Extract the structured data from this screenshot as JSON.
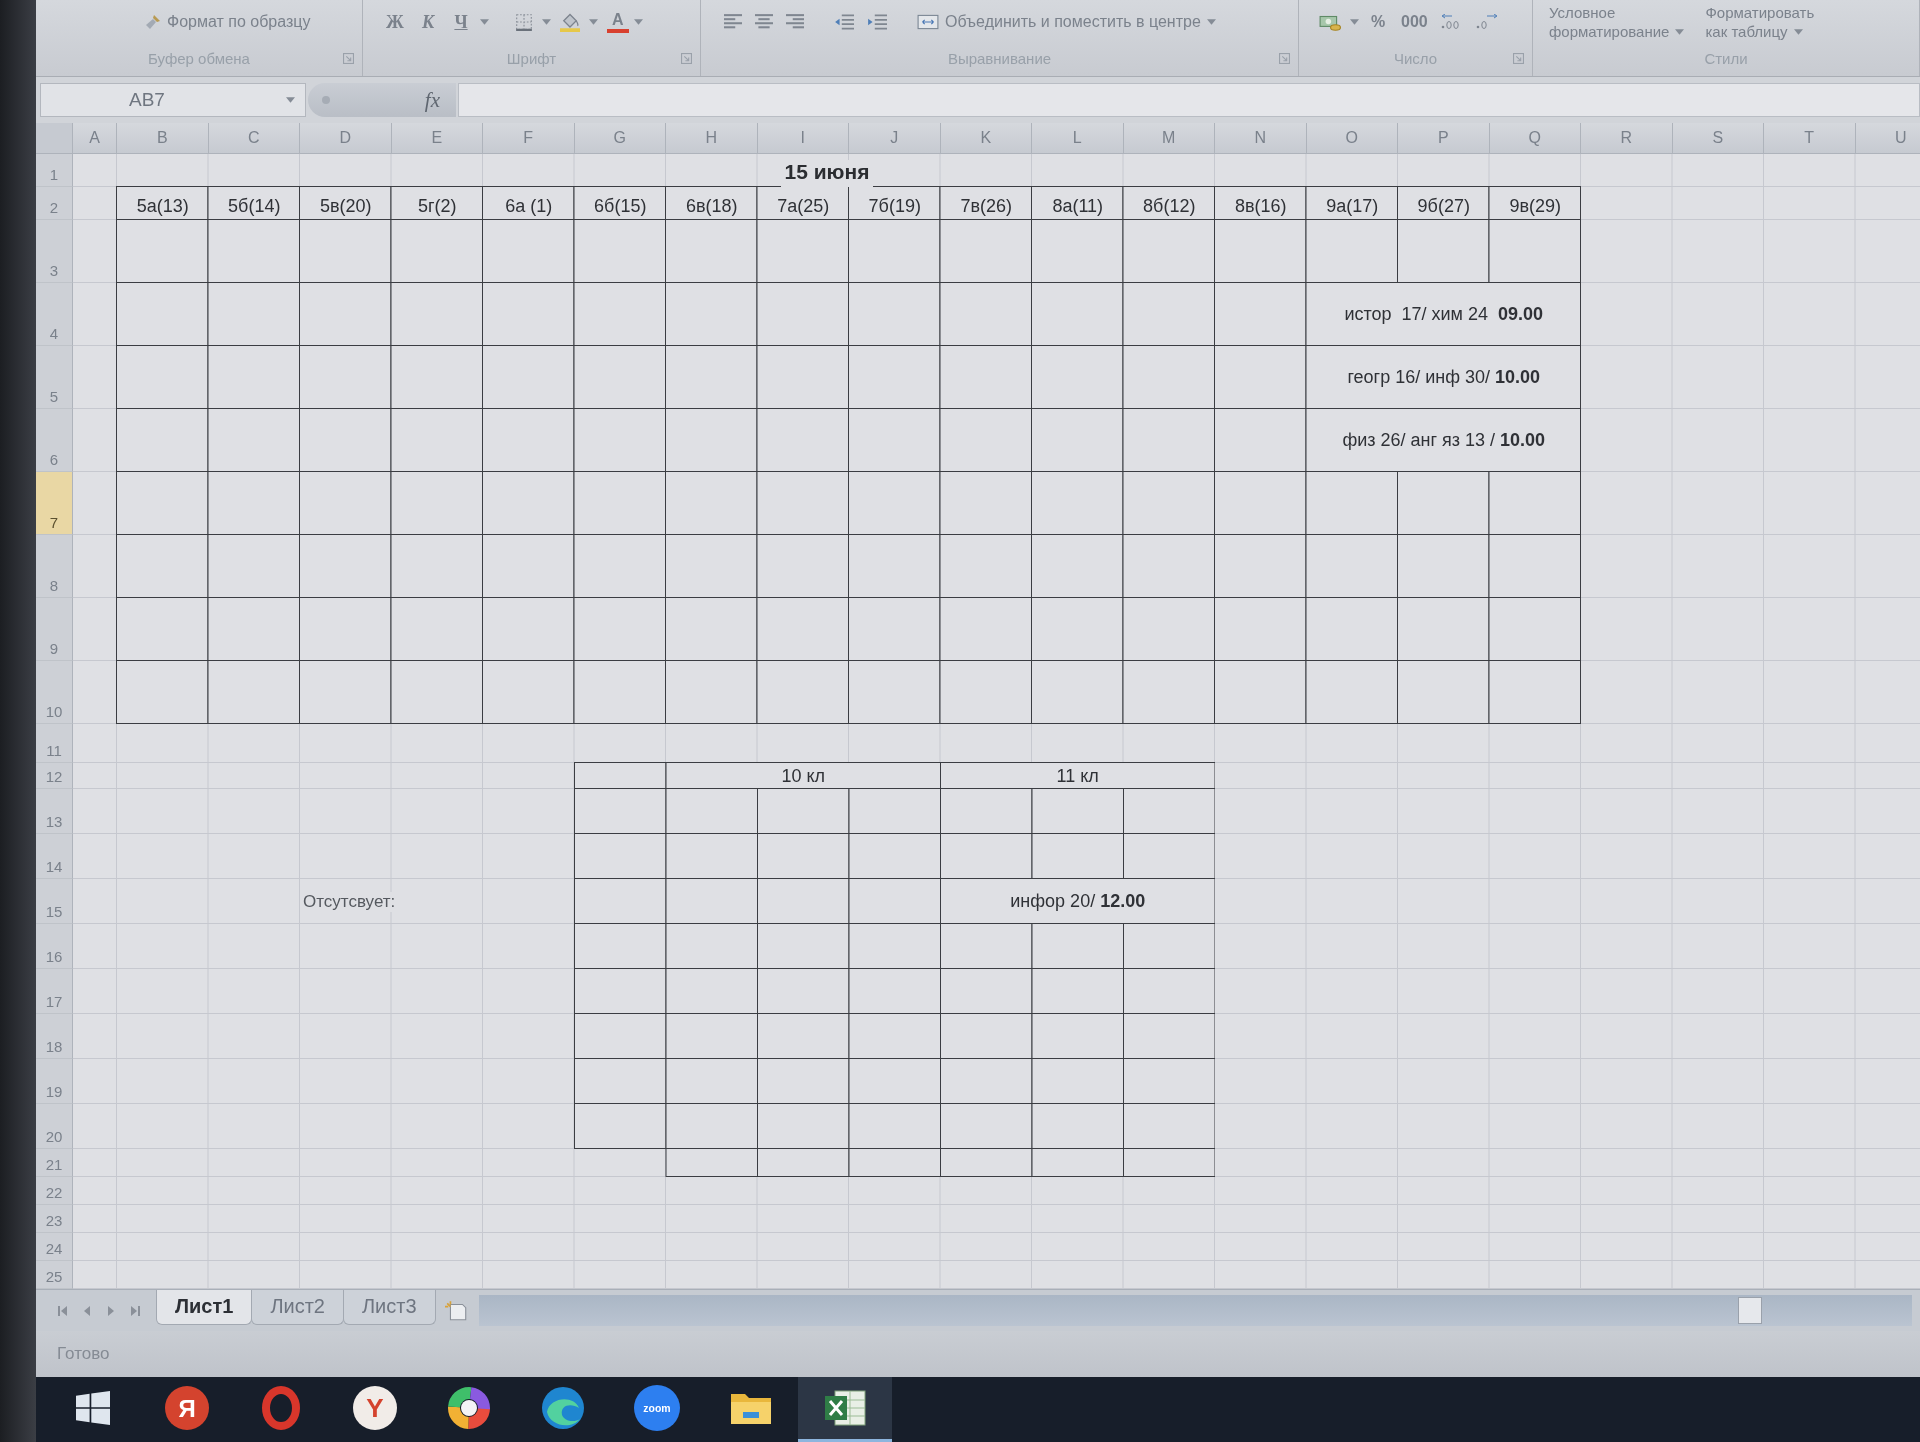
{
  "ribbon": {
    "clipboard": {
      "format_painter": "Формат по образцу",
      "label": "Буфер обмена"
    },
    "font": {
      "buttons": [
        "Ж",
        "К",
        "Ч"
      ],
      "font_color": "A",
      "label": "Шрифт"
    },
    "alignment": {
      "merge": "Объединить и поместить в центре",
      "label": "Выравнивание"
    },
    "number": {
      "buttons": [
        "%",
        "000"
      ],
      "label": "Число"
    },
    "styles": {
      "buttons": [
        {
          "lines": [
            "Условное",
            "форматирование"
          ]
        },
        {
          "lines": [
            "Форматировать",
            "как таблицу"
          ]
        }
      ],
      "label": "Стили"
    }
  },
  "formula_bar": {
    "name_box": "AB7",
    "function_glyph": "fx"
  },
  "sheet": {
    "column_headers": [
      "A",
      "B",
      "C",
      "D",
      "E",
      "F",
      "G",
      "H",
      "I",
      "J",
      "K",
      "L",
      "M",
      "N",
      "O",
      "P",
      "Q",
      "R",
      "S",
      "T",
      "U"
    ],
    "row_headers": [
      {
        "label": "1",
        "selected": false
      },
      {
        "label": "2",
        "selected": false
      },
      {
        "label": "3",
        "selected": false
      },
      {
        "label": "4",
        "selected": false
      },
      {
        "label": "5",
        "selected": false
      },
      {
        "label": "6",
        "selected": false
      },
      {
        "label": "7",
        "selected": true
      },
      {
        "label": "8",
        "selected": false
      },
      {
        "label": "9",
        "selected": false
      },
      {
        "label": "10",
        "selected": false
      },
      {
        "label": "11",
        "selected": false
      },
      {
        "label": "12",
        "selected": false
      },
      {
        "label": "13",
        "selected": false
      },
      {
        "label": "14",
        "selected": false
      },
      {
        "label": "15",
        "selected": false
      },
      {
        "label": "16",
        "selected": false
      },
      {
        "label": "17",
        "selected": false
      },
      {
        "label": "18",
        "selected": false
      },
      {
        "label": "19",
        "selected": false
      },
      {
        "label": "20",
        "selected": false
      },
      {
        "label": "21",
        "selected": false
      },
      {
        "label": "22",
        "selected": false
      },
      {
        "label": "23",
        "selected": false
      },
      {
        "label": "24",
        "selected": false
      },
      {
        "label": "25",
        "selected": false
      }
    ],
    "title": "15 июня",
    "classes": [
      "5а(13)",
      "5б(14)",
      "5в(20)",
      "5г(2)",
      "6а (1)",
      "6б(15)",
      "6в(18)",
      "7а(25)",
      "7б(19)",
      "7в(26)",
      "8а(11)",
      "8б(12)",
      "8в(16)",
      "9а(17)",
      "9б(27)",
      "9в(29)"
    ],
    "exam_notes": [
      "истор  17/ хим 24  **09.00**",
      "геогр 16/ инф 30/ **10.00**",
      "физ 26/ анг яз 13 / **10.00**"
    ],
    "absent_label": "Отсутсвует:",
    "senior_table": {
      "groups": [
        "10 кл",
        "11 кл"
      ],
      "notes": [
        "инфор 20/ **12.00**"
      ]
    }
  },
  "sheet_tabs": [
    {
      "label": "Лист1",
      "selected": true
    },
    {
      "label": "Лист2",
      "selected": false
    },
    {
      "label": "Лист3",
      "selected": false
    }
  ],
  "status_bar": {
    "text": "Готово"
  },
  "taskbar": {
    "items": [
      {
        "kind": "start",
        "selected": false
      },
      {
        "kind": "letter-disc",
        "glyph": "Я",
        "selected": false
      },
      {
        "kind": "ring",
        "selected": false
      },
      {
        "kind": "inverse-letter-disc",
        "glyph": "Y",
        "selected": false
      },
      {
        "kind": "swirl",
        "selected": false
      },
      {
        "kind": "wave",
        "selected": false
      },
      {
        "kind": "text-disc",
        "glyph": "zoom",
        "selected": false
      },
      {
        "kind": "folder",
        "selected": false
      },
      {
        "kind": "sheet",
        "selected": true
      }
    ]
  }
}
